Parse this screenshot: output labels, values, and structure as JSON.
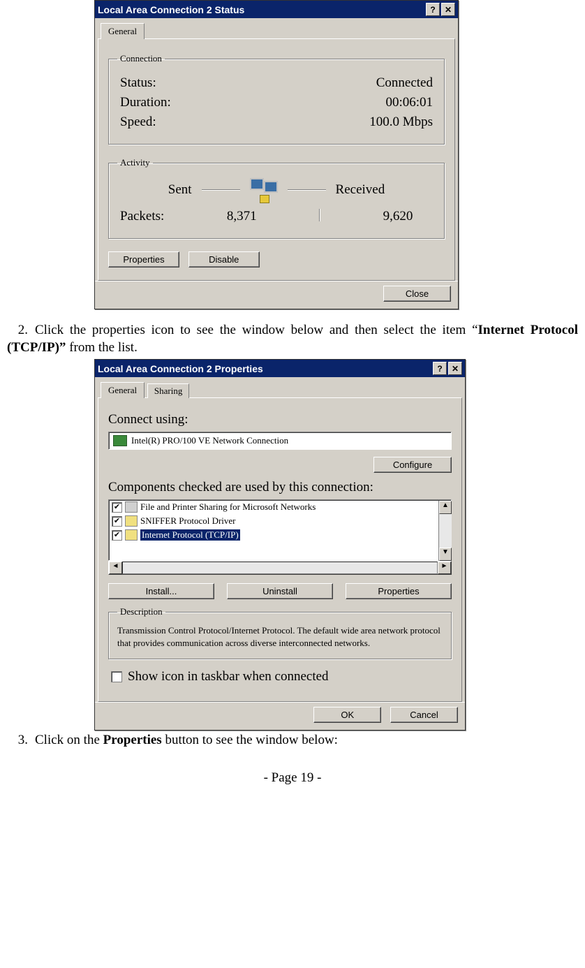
{
  "status_dialog": {
    "title": "Local Area Connection 2 Status",
    "tab_general": "General",
    "connection_legend": "Connection",
    "status_label": "Status:",
    "status_value": "Connected",
    "duration_label": "Duration:",
    "duration_value": "00:06:01",
    "speed_label": "Speed:",
    "speed_value": "100.0 Mbps",
    "activity_legend": "Activity",
    "sent_label": "Sent",
    "received_label": "Received",
    "packets_label": "Packets:",
    "packets_sent": "8,371",
    "packets_received": "9,620",
    "properties_btn": "Properties",
    "disable_btn": "Disable",
    "close_btn": "Close"
  },
  "step2": {
    "num": "2.",
    "text_a": "Click the properties icon to see the window below and then select the item “",
    "bold": "Internet Protocol (TCP/IP)”",
    "text_b": " from the list."
  },
  "props_dialog": {
    "title": "Local Area Connection 2 Properties",
    "tab_general": "General",
    "tab_sharing": "Sharing",
    "connect_using_label": "Connect using:",
    "adapter_name": "Intel(R) PRO/100 VE Network Connection",
    "configure_btn": "Configure",
    "components_label": "Components checked are used by this connection:",
    "items": [
      "File and Printer Sharing for Microsoft Networks",
      "SNIFFER Protocol Driver",
      "Internet Protocol (TCP/IP)"
    ],
    "install_btn": "Install...",
    "uninstall_btn": "Uninstall",
    "properties_btn": "Properties",
    "description_legend": "Description",
    "description_text": "Transmission Control Protocol/Internet Protocol. The default wide area network protocol that provides communication across diverse interconnected networks.",
    "show_icon_label": "Show icon in taskbar when connected",
    "ok_btn": "OK",
    "cancel_btn": "Cancel"
  },
  "step3": {
    "num": "3.",
    "text_a": "Click on the ",
    "bold": "Properties",
    "text_b": " button to see the window below:"
  },
  "page_number": "- Page 19 -"
}
